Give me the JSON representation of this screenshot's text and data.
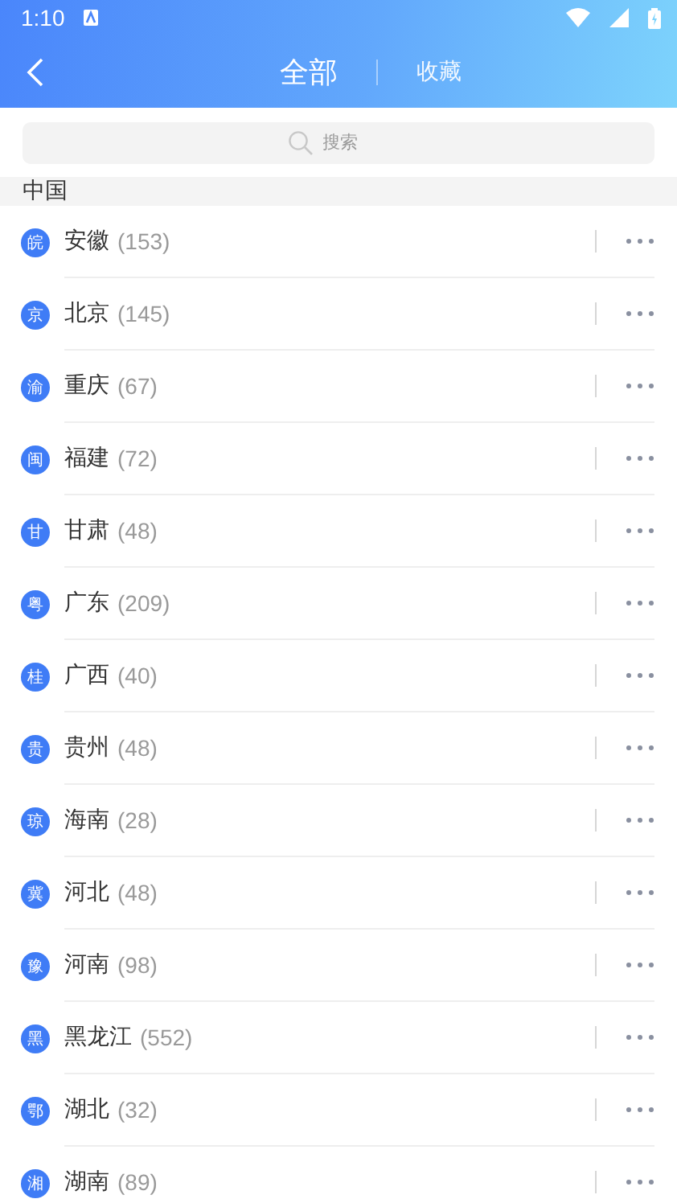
{
  "status_bar": {
    "time": "1:10"
  },
  "tabs": [
    {
      "label": "全部",
      "selected": true
    },
    {
      "label": "收藏",
      "selected": false
    }
  ],
  "search": {
    "placeholder": "搜索"
  },
  "section": "中国",
  "regions": [
    {
      "abbr": "皖",
      "name": "安徽",
      "count": "(153)"
    },
    {
      "abbr": "京",
      "name": "北京",
      "count": "(145)"
    },
    {
      "abbr": "渝",
      "name": "重庆",
      "count": "(67)"
    },
    {
      "abbr": "闽",
      "name": "福建",
      "count": "(72)"
    },
    {
      "abbr": "甘",
      "name": "甘肃",
      "count": "(48)"
    },
    {
      "abbr": "粤",
      "name": "广东",
      "count": "(209)"
    },
    {
      "abbr": "桂",
      "name": "广西",
      "count": "(40)"
    },
    {
      "abbr": "贵",
      "name": "贵州",
      "count": "(48)"
    },
    {
      "abbr": "琼",
      "name": "海南",
      "count": "(28)"
    },
    {
      "abbr": "冀",
      "name": "河北",
      "count": "(48)"
    },
    {
      "abbr": "豫",
      "name": "河南",
      "count": "(98)"
    },
    {
      "abbr": "黑",
      "name": "黑龙江",
      "count": "(552)"
    },
    {
      "abbr": "鄂",
      "name": "湖北",
      "count": "(32)"
    },
    {
      "abbr": "湘",
      "name": "湖南",
      "count": "(89)"
    }
  ]
}
